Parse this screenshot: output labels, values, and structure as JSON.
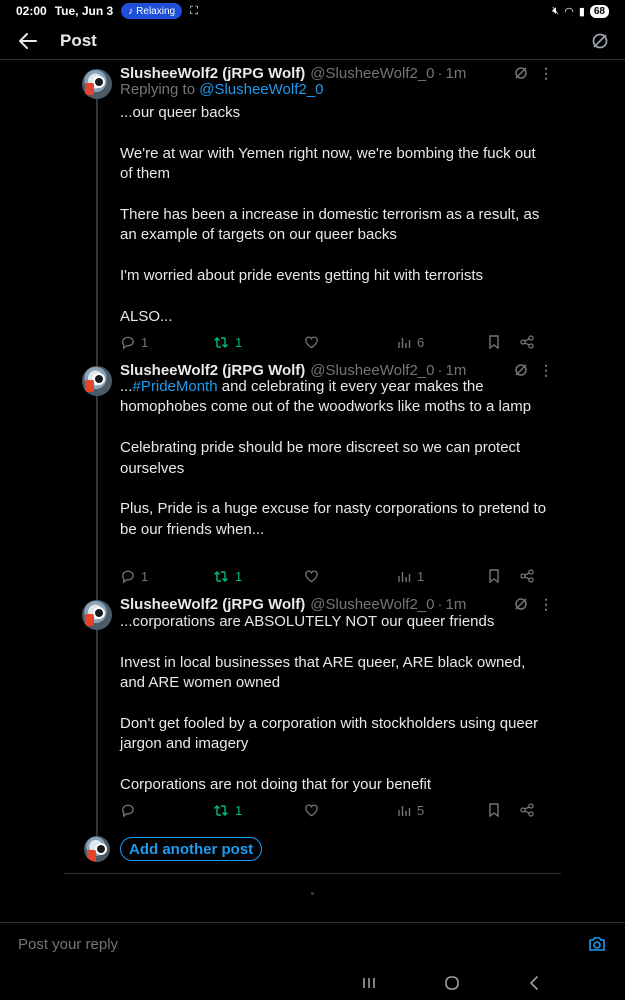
{
  "status_bar": {
    "time": "02:00",
    "date": "Tue, Jun 3",
    "media_label": "Relaxing",
    "battery": "68"
  },
  "header": {
    "title": "Post"
  },
  "posts": [
    {
      "name": "SlusheeWolf2 (jRPG Wolf)",
      "handle": "@SlusheeWolf2_0",
      "time": "1m",
      "replying_prefix": "Replying to",
      "replying_to": "@SlusheeWolf2_0",
      "paragraphs": [
        "...our queer backs",
        "We're at war with Yemen right now, we're bombing the fuck out of them",
        "There has been a increase in domestic terrorism as a result, as an example of targets on our queer backs",
        "I'm worried about pride events getting hit with terrorists",
        "ALSO..."
      ],
      "replies": "1",
      "reposts": "1",
      "likes": "",
      "views": "6"
    },
    {
      "name": "SlusheeWolf2 (jRPG Wolf)",
      "handle": "@SlusheeWolf2_0",
      "time": "1m",
      "lead": "...",
      "hashtag": "#PrideMonth",
      "first_rest": " and celebrating it every year makes the homophobes come out of the woodworks like moths to a lamp",
      "paragraphs": [
        "Celebrating pride should be more discreet so we can protect ourselves",
        "Plus, Pride is a huge excuse for nasty corporations to pretend to be our friends when..."
      ],
      "replies": "1",
      "reposts": "1",
      "likes": "",
      "views": "1"
    },
    {
      "name": "SlusheeWolf2 (jRPG Wolf)",
      "handle": "@SlusheeWolf2_0",
      "time": "1m",
      "paragraphs": [
        "...corporations are ABSOLUTELY NOT our queer friends",
        "Invest in local businesses that ARE queer, ARE black owned, and ARE women owned",
        "Don't get fooled by a corporation with stockholders using queer jargon and imagery",
        "Corporations are not doing that for your benefit"
      ],
      "replies": "",
      "reposts": "1",
      "likes": "",
      "views": "5"
    }
  ],
  "composer": {
    "add_label": "Add another post",
    "reply_placeholder": "Post your reply"
  },
  "colors": {
    "accent": "#1d9bf0",
    "repost": "#00ba7c",
    "muted": "#71767b",
    "text": "#e7e9ea",
    "background": "#000000"
  }
}
